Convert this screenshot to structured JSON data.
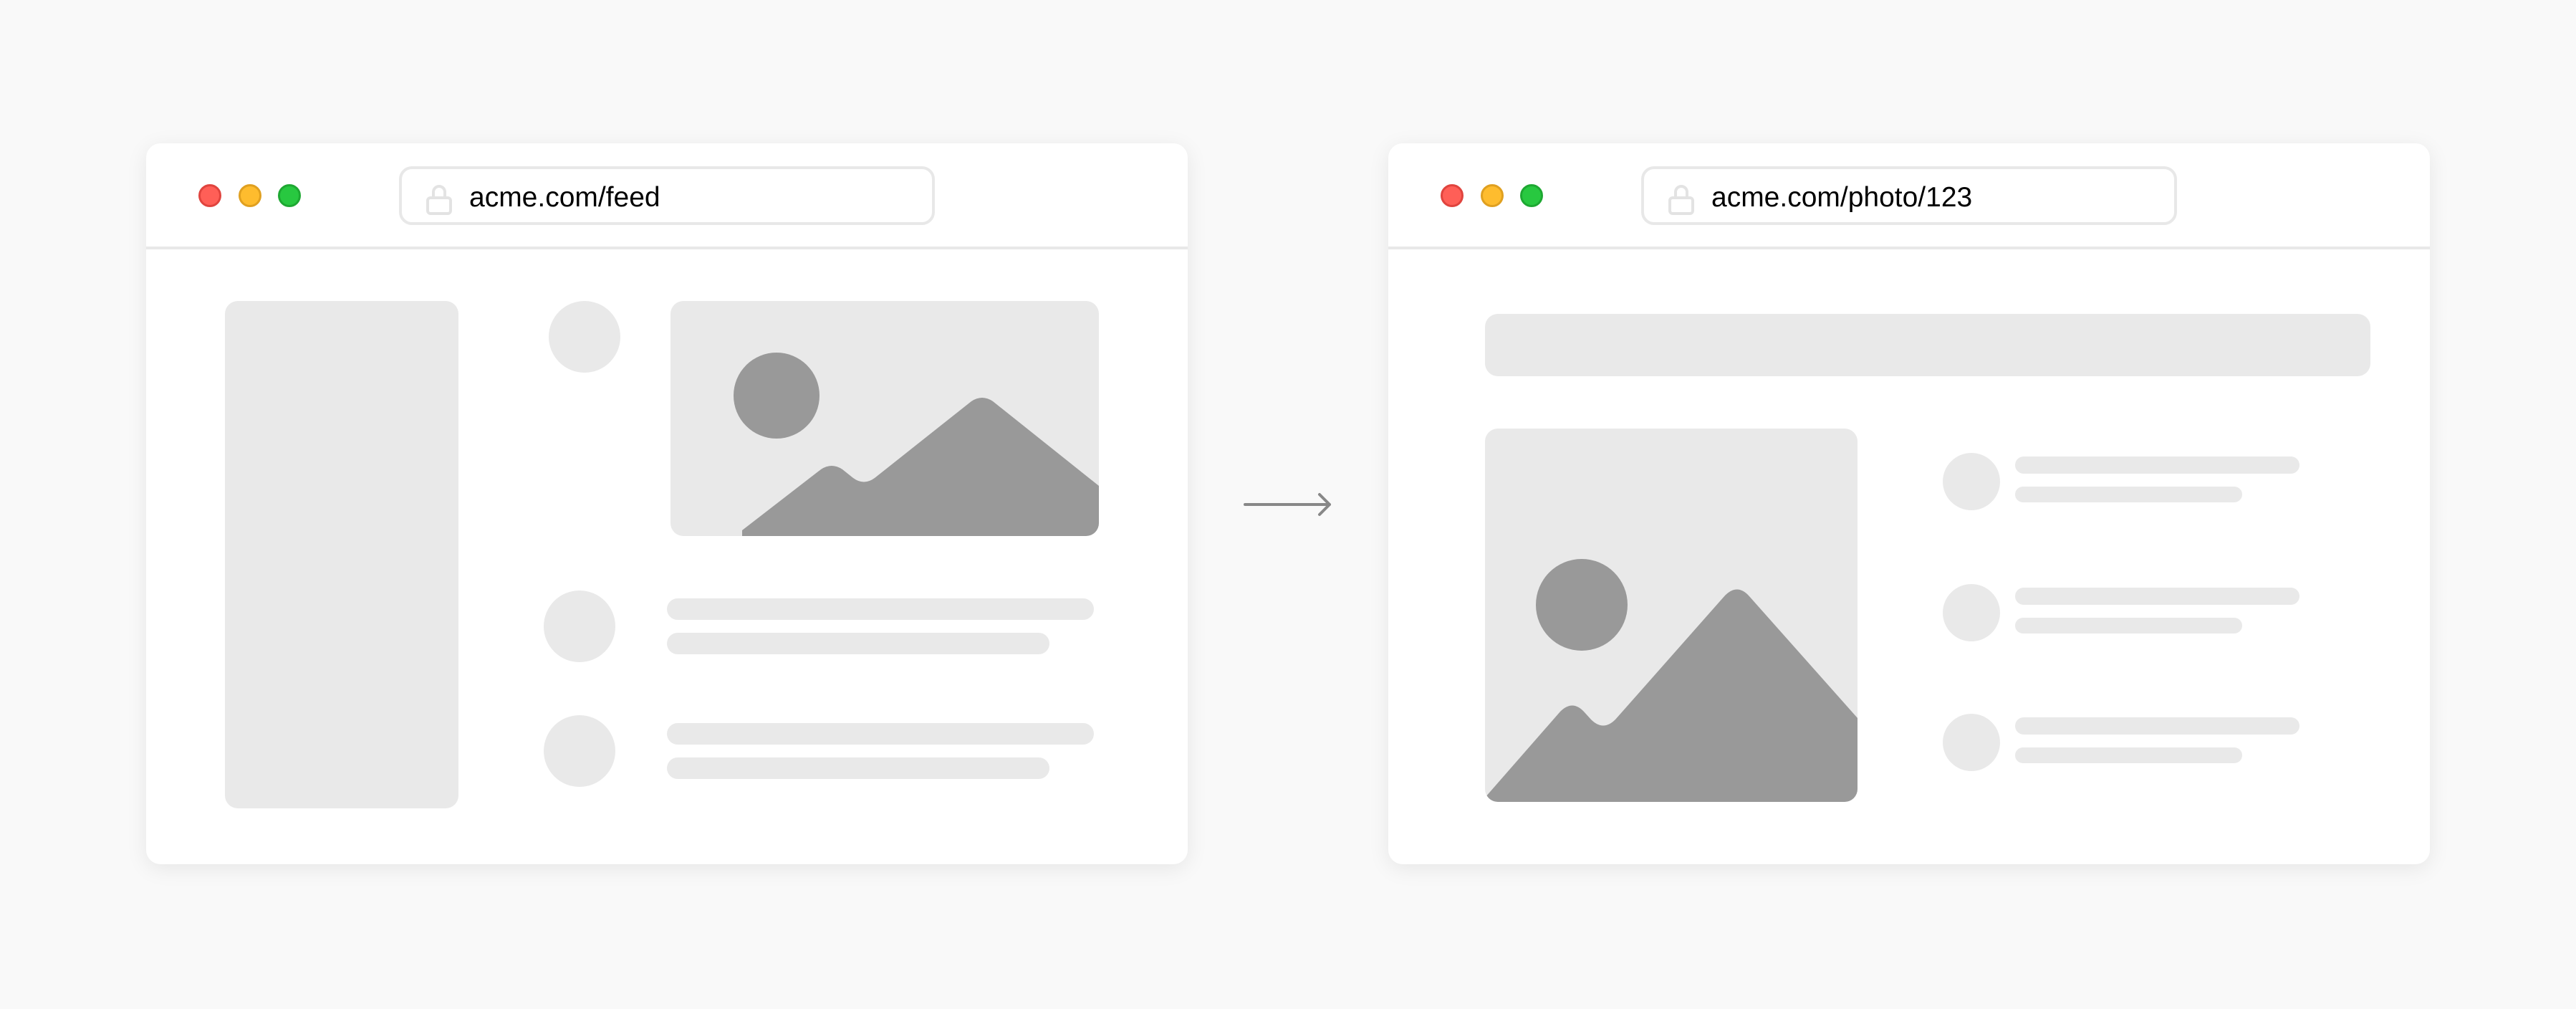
{
  "left_window": {
    "url": "acme.com/feed"
  },
  "right_window": {
    "url": "acme.com/photo/123"
  },
  "arrow": "arrow-right-icon",
  "colors": {
    "close": "#ff5f57",
    "minimize": "#febc2e",
    "maximize": "#28c840",
    "placeholder": "#e9e9e9",
    "image_shape": "#999999"
  }
}
